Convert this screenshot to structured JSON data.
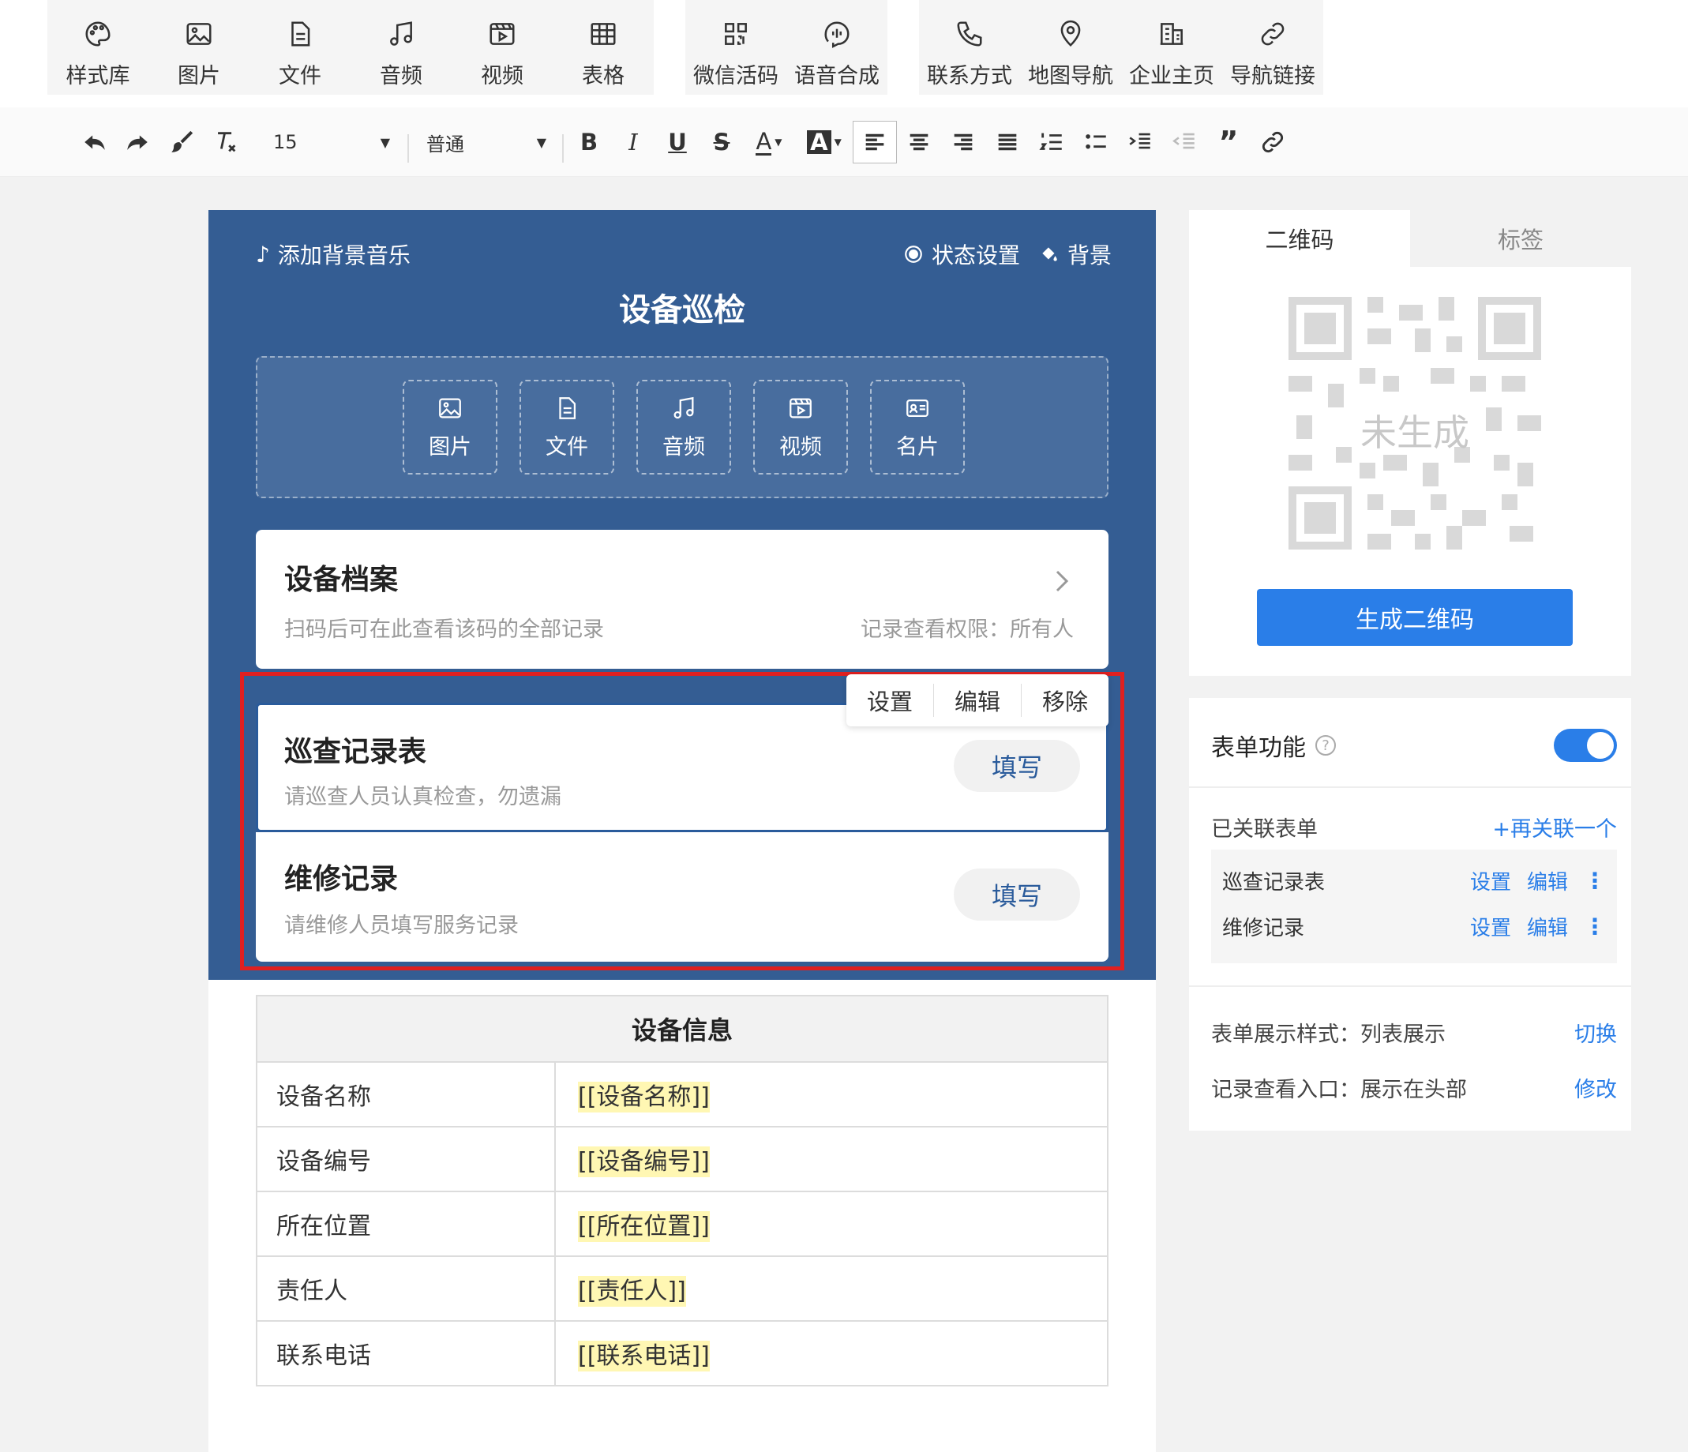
{
  "toolbar": {
    "groups": [
      [
        {
          "label": "样式库",
          "icon": "palette-icon"
        },
        {
          "label": "图片",
          "icon": "image-icon"
        },
        {
          "label": "文件",
          "icon": "file-icon"
        },
        {
          "label": "音频",
          "icon": "music-icon"
        },
        {
          "label": "视频",
          "icon": "video-icon"
        },
        {
          "label": "表格",
          "icon": "table-icon"
        }
      ],
      [
        {
          "label": "微信活码",
          "icon": "qrcode-icon"
        },
        {
          "label": "语音合成",
          "icon": "voice-icon"
        }
      ],
      [
        {
          "label": "联系方式",
          "icon": "phone-icon"
        },
        {
          "label": "地图导航",
          "icon": "map-pin-icon"
        },
        {
          "label": "企业主页",
          "icon": "building-icon"
        },
        {
          "label": "导航链接",
          "icon": "link-icon"
        }
      ]
    ]
  },
  "format_bar": {
    "font_size": "15",
    "paragraph_style": "普通"
  },
  "page": {
    "bg_music": "添加背景音乐",
    "status_setting": "状态设置",
    "background": "背景",
    "title": "设备巡检",
    "media": [
      "图片",
      "文件",
      "音频",
      "视频",
      "名片"
    ],
    "archive": {
      "title": "设备档案",
      "subtitle": "扫码后可在此查看该码的全部记录",
      "permission": "记录查看权限：所有人"
    },
    "context_menu": [
      "设置",
      "编辑",
      "移除"
    ],
    "forms": [
      {
        "title": "巡查记录表",
        "subtitle": "请巡查人员认真检查，勿遗漏",
        "button": "填写"
      },
      {
        "title": "维修记录",
        "subtitle": "请维修人员填写服务记录",
        "button": "填写"
      }
    ],
    "info_table": {
      "header": "设备信息",
      "rows": [
        {
          "key": "设备名称",
          "value": "[[设备名称]]"
        },
        {
          "key": "设备编号",
          "value": "[[设备编号]]"
        },
        {
          "key": "所在位置",
          "value": "[[所在位置]]"
        },
        {
          "key": "责任人",
          "value": "[[责任人]]"
        },
        {
          "key": "联系电话",
          "value": "[[联系电话]]"
        }
      ]
    }
  },
  "right_panel": {
    "tabs": [
      "二维码",
      "标签"
    ],
    "qr_placeholder": "未生成",
    "generate_button": "生成二维码",
    "form_feature": {
      "label": "表单功能",
      "enabled": true,
      "linked_label": "已关联表单",
      "add_link": "+再关联一个",
      "linked_forms": [
        {
          "name": "巡查记录表",
          "setting": "设置",
          "edit": "编辑"
        },
        {
          "name": "维修记录",
          "setting": "设置",
          "edit": "编辑"
        }
      ],
      "display_style_label": "表单展示样式：列表展示",
      "display_style_action": "切换",
      "record_entry_label": "记录查看入口：展示在头部",
      "record_entry_action": "修改"
    }
  },
  "colors": {
    "header_blue": "#345d93",
    "accent_blue": "#2a7ee8",
    "selection_red": "#e02020",
    "toggle_on": "#2a7ee8"
  }
}
